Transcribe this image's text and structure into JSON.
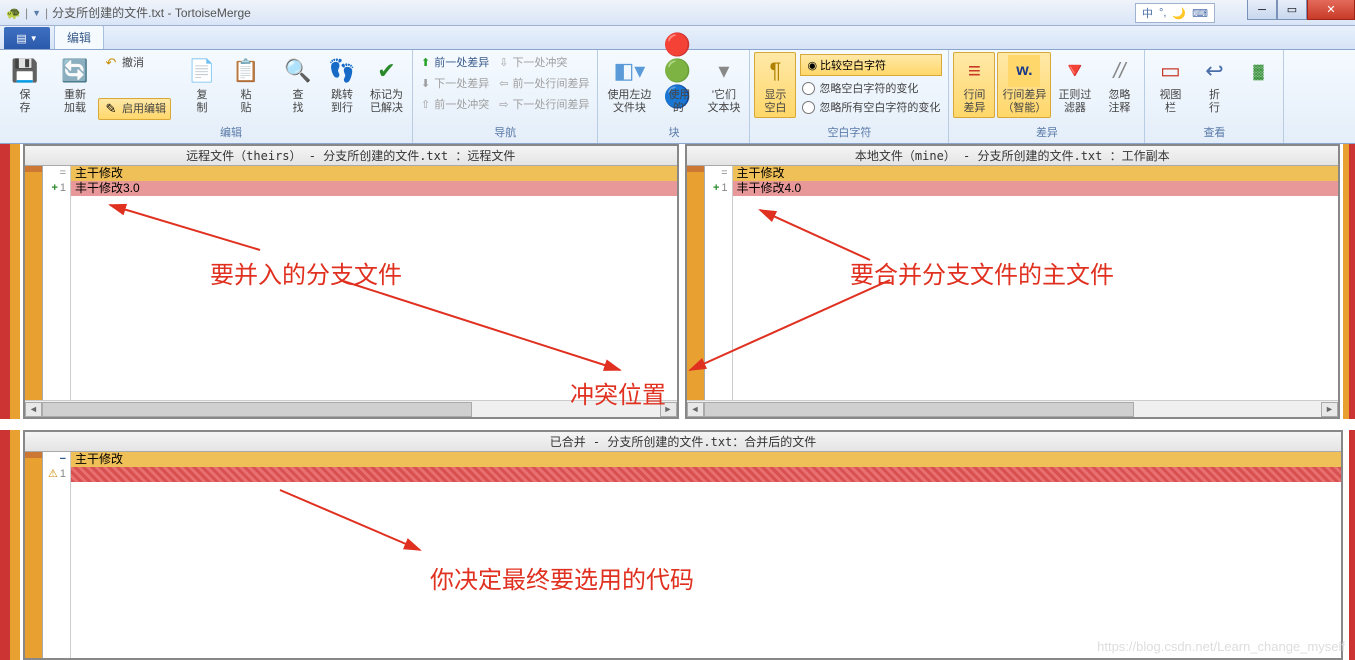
{
  "window": {
    "title_file": "分支所创建的文件.txt",
    "title_app": "TortoiseMerge"
  },
  "ime": {
    "lang": "中"
  },
  "tabs": {
    "edit": "编辑"
  },
  "ribbon": {
    "save": "保\n存",
    "reload": "重新\n加载",
    "undo": "撤消",
    "enable_edit": "启用编辑",
    "copy": "复\n制",
    "paste": "粘\n贴",
    "find": "查\n找",
    "goto": "跳转\n到行",
    "mark_resolved": "标记为\n已解决",
    "nav": {
      "prev_diff": "前一处差异",
      "next_diff": "下一处差异",
      "prev_conflict": "前一处冲突",
      "prev_inline": "前一处行间差异",
      "next_conflict": "下一处冲突",
      "next_inline": "下一处行间差异"
    },
    "use_left": "使用左边\n文件块",
    "use_theirs": "使用\n的'",
    "use_text": "'它们\n文本块",
    "show_ws": "显示\n空白",
    "compare_ws": "比较空白字符",
    "ignore_ws_change": "忽略空白字符的变化",
    "ignore_all_ws": "忽略所有空白字符的变化",
    "inline_diff": "行间\n差异",
    "inline_diff_word": "行间差异\n（智能）",
    "regex_filter": "正则过\n滤器",
    "ignore_comments": "忽略\n注释",
    "view_bar": "视图\n栏",
    "wrap": "折\n行",
    "groups": {
      "edit": "编辑",
      "nav": "导航",
      "block": "块",
      "ws": "空白字符",
      "diff": "差异",
      "view": "查看"
    }
  },
  "panes": {
    "theirs_header": "远程文件（theirs）  -  分支所创建的文件.txt ：远程文件",
    "mine_header": "本地文件（mine）  -  分支所创建的文件.txt ：工作副本",
    "merged_header": "已合并  -  分支所创建的文件.txt：合并后的文件",
    "theirs": {
      "ctx": "主干修改",
      "line1": "丰干修改3.0"
    },
    "mine": {
      "ctx": "主干修改",
      "line1": "丰干修改4.0"
    },
    "merged": {
      "ctx": "主干修改"
    }
  },
  "anno": {
    "theirs": "要并入的分支文件",
    "mine": "要合并分支文件的主文件",
    "conflict": "冲突位置",
    "merged": "你决定最终要选用的代码"
  },
  "watermark": "https://blog.csdn.net/Learn_change_myself"
}
